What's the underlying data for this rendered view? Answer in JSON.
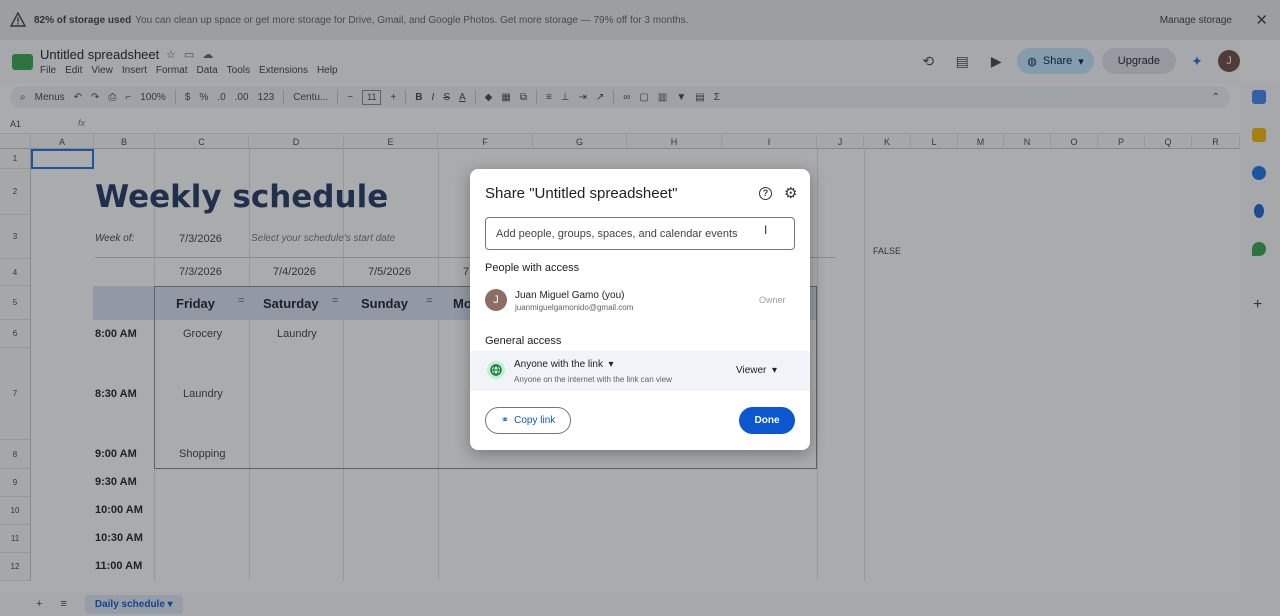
{
  "banner": {
    "bold": "82% of storage used",
    "text": "You can clean up space or get more storage for Drive, Gmail, and Google Photos. Get more storage — 79% off for 3 months.",
    "manage": "Manage storage",
    "close": "✕"
  },
  "doc": {
    "title": "Untitled spreadsheet"
  },
  "menu": [
    "File",
    "Edit",
    "View",
    "Insert",
    "Format",
    "Data",
    "Tools",
    "Extensions",
    "Help"
  ],
  "header": {
    "share": "Share",
    "upgrade": "Upgrade",
    "avatar": "J"
  },
  "toolbar": {
    "menus": "Menus",
    "zoom": "100%",
    "currency": "$",
    "percent": "%",
    "dec_less": ".0",
    "dec_more": ".00",
    "number_fmt": "123",
    "font": "Centu...",
    "font_size": "11",
    "bold": "B",
    "italic": "I",
    "strike": "S",
    "textcolor": "A",
    "sum": "Σ"
  },
  "formula": {
    "cell_ref": "A1",
    "fx": "fx"
  },
  "columns": [
    "A",
    "B",
    "C",
    "D",
    "E",
    "F",
    "G",
    "H",
    "I",
    "J",
    "K",
    "L",
    "M",
    "N",
    "O",
    "P",
    "Q",
    "R"
  ],
  "rows": [
    "1",
    "2",
    "3",
    "4",
    "5",
    "6",
    "7",
    "8",
    "9",
    "10",
    "11",
    "12"
  ],
  "sheet": {
    "title": "Weekly schedule",
    "week_of_label": "Week of:",
    "week_of_value": "7/3/2026",
    "hint": "Select your schedule's start date",
    "dates": [
      "7/3/2026",
      "7/4/2026",
      "7/5/2026",
      "7"
    ],
    "days": [
      "Friday",
      "Saturday",
      "Sunday",
      "Mo"
    ],
    "times": [
      "8:00 AM",
      "8:30 AM",
      "9:00 AM",
      "9:30 AM",
      "10:00 AM",
      "10:30 AM",
      "11:00 AM"
    ],
    "tasks": {
      "grocery": "Grocery",
      "laundry_sat": "Laundry",
      "laundry_fri": "Laundry",
      "shopping": "Shopping"
    },
    "false_cell": "FALSE"
  },
  "bottom": {
    "add": "+",
    "list": "≡",
    "tab": "Daily schedule"
  },
  "dialog": {
    "title": "Share \"Untitled spreadsheet\"",
    "input_placeholder": "Add people, groups, spaces, and calendar events",
    "people_heading": "People with access",
    "person_initial": "J",
    "person_name": "Juan Miguel Gamo (you)",
    "person_email": "juanmiguelgamonido@gmail.com",
    "person_role": "Owner",
    "general_heading": "General access",
    "access_title": "Anyone with the link",
    "access_desc": "Anyone on the internet with the link can view",
    "role": "Viewer",
    "copy_link": "Copy link",
    "done": "Done"
  },
  "colors": {
    "accent": "#0b57d0",
    "share_bg": "#c2e7ff",
    "title_blue": "#1f3864",
    "day_header": "#d9e2f3",
    "sheets_green": "#34a853"
  }
}
